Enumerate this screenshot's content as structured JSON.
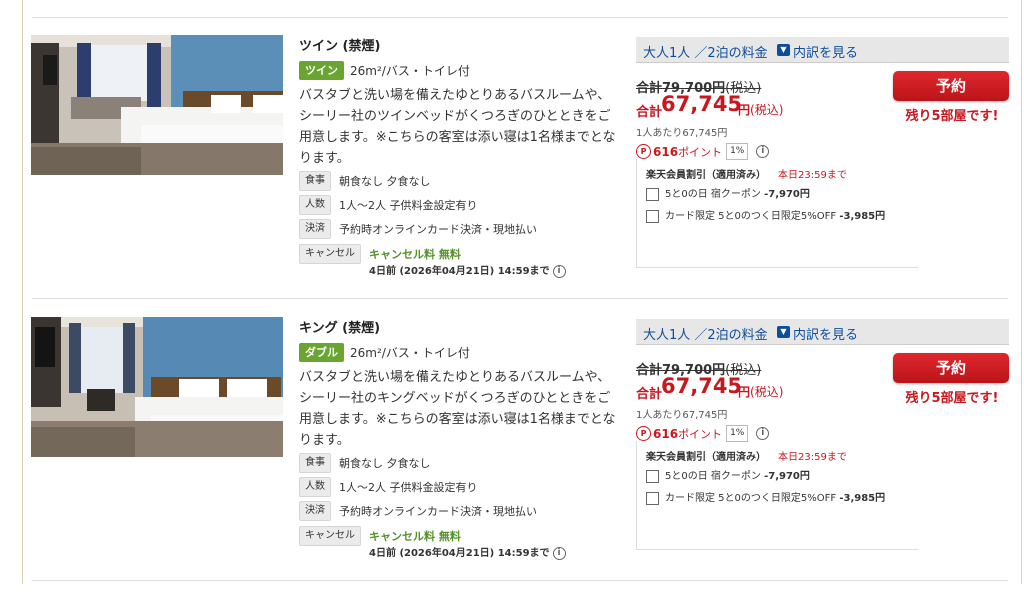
{
  "rooms": [
    {
      "name": "ツイン (禁煙)",
      "type": "ツイン",
      "size": "26m²/バス・トイレ付",
      "description": "バスタブと洗い場を備えたゆとりあるバスルームや、シーリー社のツインベッドがくつろぎのひとときをご用意します。※こちらの客室は添い寝は1名様までとなります。",
      "meal_tag": "食事",
      "meal": "朝食なし 夕食なし",
      "people_tag": "人数",
      "people": "1人～2人 子供料金設定有り",
      "payment_tag": "決済",
      "payment": "予約時オンラインカード決済・現地払い",
      "cancel_tag": "キャンセル",
      "cancel": "キャンセル料 無料",
      "cancel_deadline": "4日前 (2026年04月21日) 14:59まで",
      "price_header": "大人1人 ／2泊の料金",
      "breakdown_link": "内訳を見る",
      "original_price": "合計79,700円",
      "original_tax": "(税込)",
      "sale_label": "合計",
      "sale_price": "67,745",
      "sale_yen": "円",
      "sale_tax": "(税込)",
      "per_person": "1人あたり67,745円",
      "points": "616",
      "points_suffix": "ポイント",
      "point_rate": "1%",
      "member_discount": "楽天会員割引（適用済み）",
      "member_deadline": "本日23:59まで",
      "coupon1_label": "5と0の日 宿クーポン",
      "coupon1_amount": "-7,970円",
      "coupon2_label": "カード限定 5と0のつく日限定5%OFF",
      "coupon2_amount": "-3,985円",
      "reserve": "予約",
      "rooms_left": "残り5部屋です!"
    },
    {
      "name": "キング (禁煙)",
      "type": "ダブル",
      "size": "26m²/バス・トイレ付",
      "description": "バスタブと洗い場を備えたゆとりあるバスルームや、シーリー社のキングベッドがくつろぎのひとときをご用意します。※こちらの客室は添い寝は1名様までとなります。",
      "meal_tag": "食事",
      "meal": "朝食なし 夕食なし",
      "people_tag": "人数",
      "people": "1人～2人 子供料金設定有り",
      "payment_tag": "決済",
      "payment": "予約時オンラインカード決済・現地払い",
      "cancel_tag": "キャンセル",
      "cancel": "キャンセル料 無料",
      "cancel_deadline": "4日前 (2026年04月21日) 14:59まで",
      "price_header": "大人1人 ／2泊の料金",
      "breakdown_link": "内訳を見る",
      "original_price": "合計79,700円",
      "original_tax": "(税込)",
      "sale_label": "合計",
      "sale_price": "67,745",
      "sale_yen": "円",
      "sale_tax": "(税込)",
      "per_person": "1人あたり67,745円",
      "points": "616",
      "points_suffix": "ポイント",
      "point_rate": "1%",
      "member_discount": "楽天会員割引（適用済み）",
      "member_deadline": "本日23:59まで",
      "coupon1_label": "5と0の日 宿クーポン",
      "coupon1_amount": "-7,970円",
      "coupon2_label": "カード限定 5と0のつく日限定5%OFF",
      "coupon2_amount": "-3,985円",
      "reserve": "予約",
      "rooms_left": "残り5部屋です!"
    }
  ],
  "colors": {
    "accent_red": "#c9171e",
    "link_blue": "#0e4d9c",
    "badge_green": "#6aa431"
  },
  "icons": {
    "breakdown": "chevron-down-icon",
    "info": "info-icon",
    "points": "points-icon",
    "coupon": "coupon-icon"
  }
}
